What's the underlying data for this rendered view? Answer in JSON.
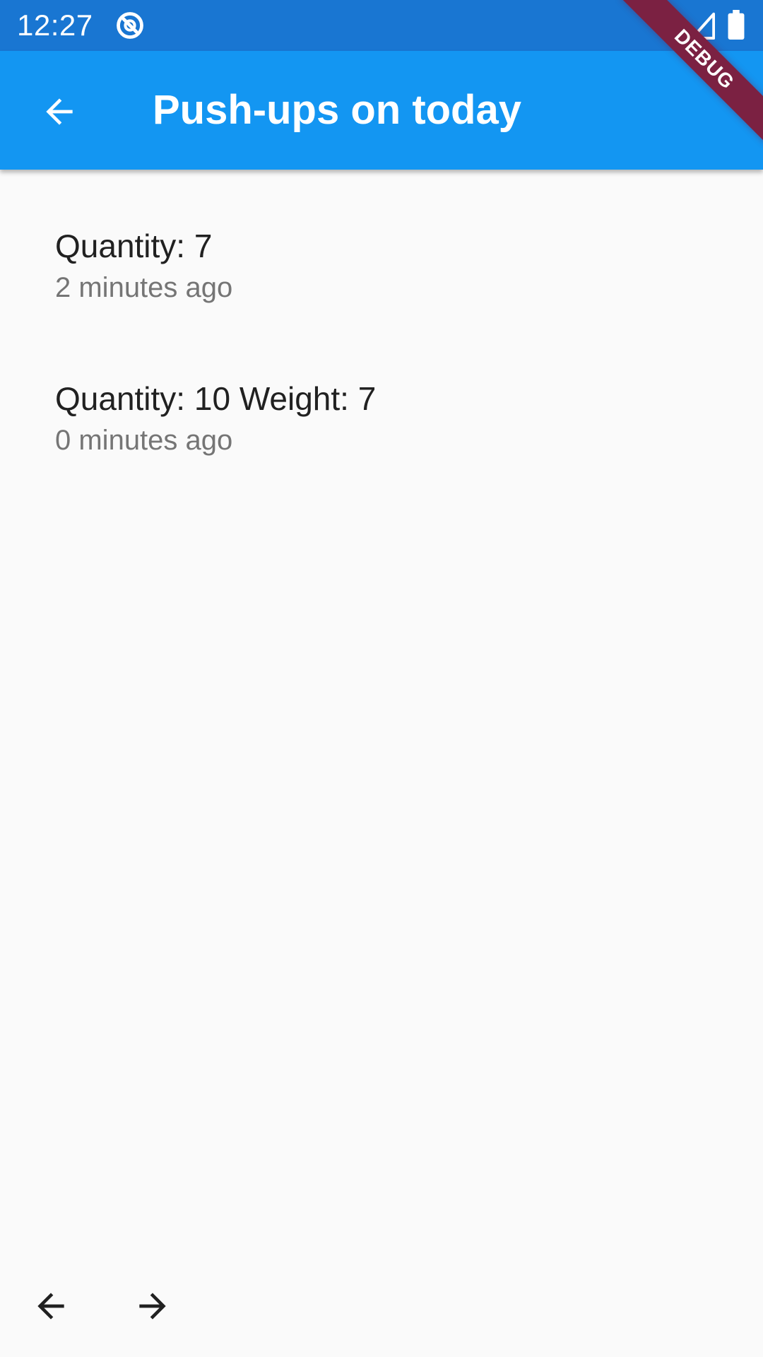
{
  "status_bar": {
    "time": "12:27"
  },
  "app_bar": {
    "title": "Push-ups on today"
  },
  "debug_banner": "DEBUG",
  "entries": [
    {
      "title": "Quantity: 7",
      "subtitle": "2 minutes ago"
    },
    {
      "title": "Quantity: 10 Weight: 7",
      "subtitle": "0 minutes ago"
    }
  ],
  "icons": {
    "back": "arrow-back-icon",
    "previous": "arrow-back-icon",
    "next": "arrow-forward-icon"
  },
  "colors": {
    "status_bar": "#1976d2",
    "app_bar": "#1396f2",
    "background": "#fafafa",
    "debug_banner": "#7b2142"
  }
}
